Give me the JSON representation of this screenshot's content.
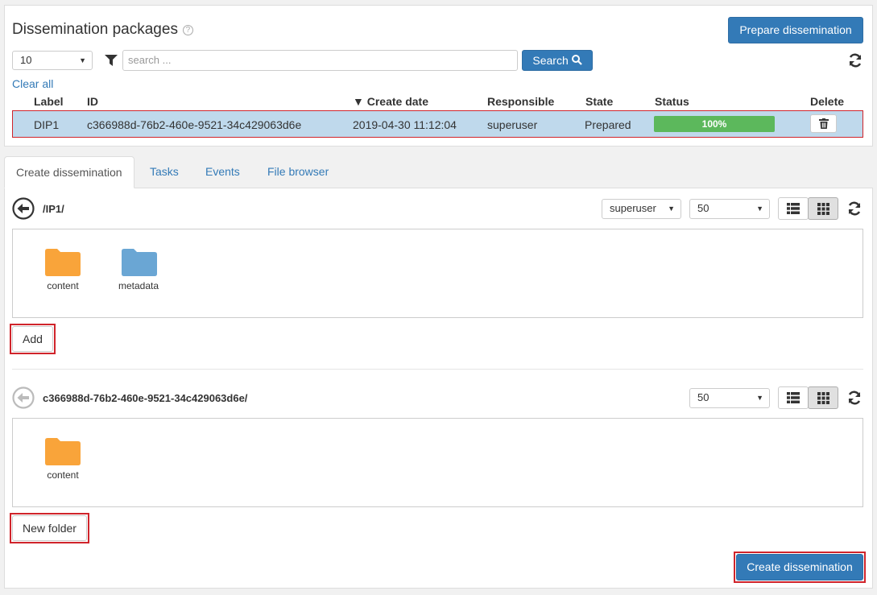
{
  "header": {
    "title": "Dissemination packages",
    "help_icon": "?",
    "prepare_button": "Prepare dissemination",
    "page_size": "10",
    "search_placeholder": "search ...",
    "search_button": "Search",
    "clear_all": "Clear all"
  },
  "table": {
    "columns": [
      "Label",
      "ID",
      "▼ Create date",
      "Responsible",
      "State",
      "Status",
      "Delete"
    ],
    "rows": [
      {
        "label": "DIP1",
        "id": "c366988d-76b2-460e-9521-34c429063d6e",
        "create_date": "2019-04-30 11:12:04",
        "responsible": "superuser",
        "state": "Prepared",
        "status": "100%",
        "progress": 1.0
      }
    ]
  },
  "tabs": [
    {
      "label": "Create dissemination",
      "active": true
    },
    {
      "label": "Tasks",
      "active": false
    },
    {
      "label": "Events",
      "active": false
    },
    {
      "label": "File browser",
      "active": false
    }
  ],
  "browser1": {
    "path": "/IP1/",
    "user_select": "superuser",
    "page_size": "50",
    "items": [
      {
        "name": "content",
        "color": "#f9a43a"
      },
      {
        "name": "metadata",
        "color": "#6aa6d4"
      }
    ],
    "action_button": "Add"
  },
  "browser2": {
    "path": "c366988d-76b2-460e-9521-34c429063d6e/",
    "page_size": "50",
    "items": [
      {
        "name": "content",
        "color": "#f9a43a"
      }
    ],
    "action_button": "New folder"
  },
  "create_button": "Create dissemination",
  "colors": {
    "primary": "#337ab7",
    "highlight": "#d0242b",
    "progress": "#5cb85c",
    "selected_row": "#bfd9ec"
  }
}
